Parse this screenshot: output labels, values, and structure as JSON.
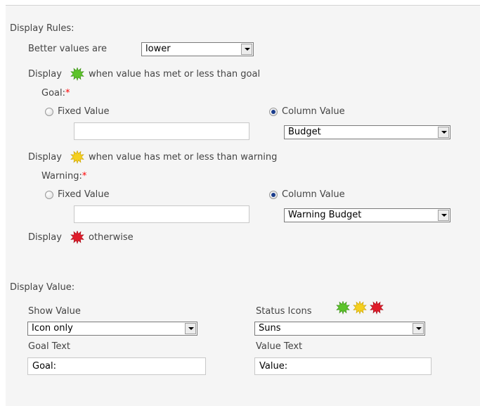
{
  "display_rules": {
    "heading": "Display Rules:",
    "better_values_label": "Better values are",
    "better_values_selected": "lower",
    "goal_line": {
      "before": "Display",
      "after": "when value has met or less than goal",
      "icon": "green-sun-icon",
      "color": "#5cc42a"
    },
    "goal": {
      "label": "Goal:",
      "required_mark": "*",
      "fixed_label": "Fixed Value",
      "fixed_value": "",
      "column_label": "Column Value",
      "column_selected": "Budget",
      "selected_option": "column"
    },
    "warning_line": {
      "before": "Display",
      "after": "when value has met or less than warning",
      "icon": "yellow-sun-icon",
      "color": "#f5d01f"
    },
    "warning": {
      "label": "Warning:",
      "required_mark": "*",
      "fixed_label": "Fixed Value",
      "fixed_value": "",
      "column_label": "Column Value",
      "column_selected": "Warning Budget",
      "selected_option": "column"
    },
    "otherwise_line": {
      "before": "Display",
      "after": "otherwise",
      "icon": "red-sun-icon",
      "color": "#e01b2a"
    }
  },
  "display_value": {
    "heading": "Display Value:",
    "show_value_label": "Show Value",
    "show_value_selected": "Icon only",
    "status_icons_label": "Status Icons",
    "status_icons_selected": "Suns",
    "goal_text_label": "Goal Text",
    "goal_text_value": "Goal:",
    "value_text_label": "Value Text",
    "value_text_value": "Value:"
  },
  "colors": {
    "panel_background": "#f5f5f5",
    "text": "#444444",
    "required": "#ff0000",
    "radio_selected": "#1a3c8c"
  }
}
